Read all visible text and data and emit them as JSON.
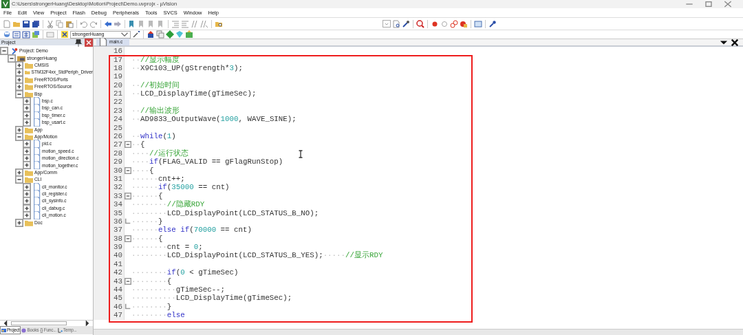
{
  "window": {
    "title": "C:\\Users\\strongerHuang\\Desktop\\Motion\\Project\\Demo.uvprojx - µVision"
  },
  "menu": [
    "File",
    "Edit",
    "View",
    "Project",
    "Flash",
    "Debug",
    "Peripherals",
    "Tools",
    "SVCS",
    "Window",
    "Help"
  ],
  "toolbar": {
    "target": "strongerHuang"
  },
  "project_panel": {
    "title": "Project",
    "tree": [
      {
        "kind": "project",
        "label": "Project: Demo",
        "expanded": true,
        "children": [
          {
            "kind": "target",
            "label": "strongerHuang",
            "expanded": true,
            "children": [
              {
                "kind": "folder",
                "label": "CMSIS",
                "expanded": false
              },
              {
                "kind": "folder",
                "label": "STM32F4xx_StdPeriph_Driver",
                "expanded": false
              },
              {
                "kind": "folder",
                "label": "FreeRTOS/Ports",
                "expanded": false
              },
              {
                "kind": "folder",
                "label": "FreeRTOS/Source",
                "expanded": false
              },
              {
                "kind": "folder",
                "label": "Bsp",
                "expanded": true,
                "children": [
                  {
                    "kind": "file",
                    "label": "bsp.c",
                    "expanded": false
                  },
                  {
                    "kind": "file",
                    "label": "bsp_can.c",
                    "expanded": false
                  },
                  {
                    "kind": "file",
                    "label": "bsp_timer.c",
                    "expanded": false
                  },
                  {
                    "kind": "file",
                    "label": "bsp_usart.c",
                    "expanded": false
                  }
                ]
              },
              {
                "kind": "folder",
                "label": "App",
                "expanded": false
              },
              {
                "kind": "folder",
                "label": "App/Motion",
                "expanded": true,
                "children": [
                  {
                    "kind": "file",
                    "label": "pid.c",
                    "expanded": false
                  },
                  {
                    "kind": "file",
                    "label": "motion_speed.c",
                    "expanded": false
                  },
                  {
                    "kind": "file",
                    "label": "motion_direction.c",
                    "expanded": false
                  },
                  {
                    "kind": "file",
                    "label": "motion_together.c",
                    "expanded": false
                  }
                ]
              },
              {
                "kind": "folder",
                "label": "App/Comm",
                "expanded": false
              },
              {
                "kind": "folder",
                "label": "CLI",
                "expanded": true,
                "children": [
                  {
                    "kind": "file",
                    "label": "cli_monitor.c",
                    "expanded": false
                  },
                  {
                    "kind": "file",
                    "label": "cli_register.c",
                    "expanded": false
                  },
                  {
                    "kind": "file",
                    "label": "cli_sysinfo.c",
                    "expanded": false
                  },
                  {
                    "kind": "file",
                    "label": "cli_dabug.c",
                    "expanded": false
                  },
                  {
                    "kind": "file",
                    "label": "cli_motion.c",
                    "expanded": false
                  }
                ]
              },
              {
                "kind": "folder",
                "label": "Doc",
                "expanded": false
              }
            ]
          }
        ]
      }
    ],
    "tabs": [
      {
        "label": "Project",
        "selected": true
      },
      {
        "label": "Books",
        "selected": false
      },
      {
        "label": "{} Func...",
        "selected": false
      },
      {
        "label": "Temp...",
        "selected": false
      }
    ]
  },
  "editor": {
    "tabs": [
      {
        "label": "main.c",
        "selected": true
      }
    ],
    "lines": [
      {
        "n": "16"
      },
      {
        "n": "17",
        "tokens": [
          {
            "kind": "ws",
            "text": "··"
          },
          {
            "kind": "cmt",
            "text": "//显示幅度"
          }
        ]
      },
      {
        "n": "18",
        "tokens": [
          {
            "kind": "ws",
            "text": "··"
          },
          {
            "kind": "code",
            "text": "X9C103_UP(gStrength*"
          },
          {
            "kind": "num",
            "text": "3"
          },
          {
            "kind": "code",
            "text": ");"
          }
        ]
      },
      {
        "n": "19"
      },
      {
        "n": "20",
        "tokens": [
          {
            "kind": "ws",
            "text": "··"
          },
          {
            "kind": "cmt",
            "text": "//初始时间"
          }
        ]
      },
      {
        "n": "21",
        "tokens": [
          {
            "kind": "ws",
            "text": "··"
          },
          {
            "kind": "code",
            "text": "LCD_DisplayTime(gTimeSec);"
          }
        ]
      },
      {
        "n": "22"
      },
      {
        "n": "23",
        "tokens": [
          {
            "kind": "ws",
            "text": "··"
          },
          {
            "kind": "cmt",
            "text": "//输出波形"
          }
        ]
      },
      {
        "n": "24",
        "tokens": [
          {
            "kind": "ws",
            "text": "··"
          },
          {
            "kind": "code",
            "text": "AD9833_OutputWave("
          },
          {
            "kind": "num",
            "text": "1000"
          },
          {
            "kind": "code",
            "text": ", WAVE_SINE);"
          }
        ]
      },
      {
        "n": "25"
      },
      {
        "n": "26",
        "tokens": [
          {
            "kind": "ws",
            "text": "··"
          },
          {
            "kind": "kw",
            "text": "while"
          },
          {
            "kind": "code",
            "text": "("
          },
          {
            "kind": "num",
            "text": "1"
          },
          {
            "kind": "code",
            "text": ")"
          }
        ]
      },
      {
        "n": "27",
        "fold_start": true,
        "tokens": [
          {
            "kind": "ws",
            "text": "··"
          },
          {
            "kind": "code",
            "text": "{"
          }
        ]
      },
      {
        "n": "28",
        "tokens": [
          {
            "kind": "ws",
            "text": "····"
          },
          {
            "kind": "cmt",
            "text": "//运行状态"
          }
        ]
      },
      {
        "n": "29",
        "tokens": [
          {
            "kind": "ws",
            "text": "····"
          },
          {
            "kind": "kw",
            "text": "if"
          },
          {
            "kind": "code",
            "text": "(FLAG_VALID == gFlagRunStop)"
          }
        ]
      },
      {
        "n": "30",
        "fold_start": true,
        "tokens": [
          {
            "kind": "ws",
            "text": "····"
          },
          {
            "kind": "code",
            "text": "{"
          }
        ]
      },
      {
        "n": "31",
        "tokens": [
          {
            "kind": "ws",
            "text": "······"
          },
          {
            "kind": "code",
            "text": "cnt++;"
          }
        ]
      },
      {
        "n": "32",
        "tokens": [
          {
            "kind": "ws",
            "text": "······"
          },
          {
            "kind": "kw",
            "text": "if"
          },
          {
            "kind": "code",
            "text": "("
          },
          {
            "kind": "num",
            "text": "35000"
          },
          {
            "kind": "code",
            "text": " == cnt)"
          }
        ]
      },
      {
        "n": "33",
        "fold_start": true,
        "tokens": [
          {
            "kind": "ws",
            "text": "······"
          },
          {
            "kind": "code",
            "text": "{"
          }
        ]
      },
      {
        "n": "34",
        "tokens": [
          {
            "kind": "ws",
            "text": "········"
          },
          {
            "kind": "cmt",
            "text": "//隐藏RDY"
          }
        ]
      },
      {
        "n": "35",
        "tokens": [
          {
            "kind": "ws",
            "text": "········"
          },
          {
            "kind": "code",
            "text": "LCD_DisplayPoint(LCD_STATUS_B_NO);"
          }
        ]
      },
      {
        "n": "36",
        "fold_end": true,
        "tokens": [
          {
            "kind": "ws",
            "text": "······"
          },
          {
            "kind": "code",
            "text": "}"
          }
        ]
      },
      {
        "n": "37",
        "tokens": [
          {
            "kind": "ws",
            "text": "······"
          },
          {
            "kind": "kw",
            "text": "else if"
          },
          {
            "kind": "code",
            "text": "("
          },
          {
            "kind": "num",
            "text": "70000"
          },
          {
            "kind": "code",
            "text": " == cnt)"
          }
        ]
      },
      {
        "n": "38",
        "fold_start": true,
        "tokens": [
          {
            "kind": "ws",
            "text": "······"
          },
          {
            "kind": "code",
            "text": "{"
          }
        ]
      },
      {
        "n": "39",
        "tokens": [
          {
            "kind": "ws",
            "text": "········"
          },
          {
            "kind": "code",
            "text": "cnt = "
          },
          {
            "kind": "num",
            "text": "0"
          },
          {
            "kind": "code",
            "text": ";"
          }
        ]
      },
      {
        "n": "40",
        "tokens": [
          {
            "kind": "ws",
            "text": "········"
          },
          {
            "kind": "code",
            "text": "LCD_DisplayPoint(LCD_STATUS_B_YES);"
          },
          {
            "kind": "ws",
            "text": "·····"
          },
          {
            "kind": "cmt",
            "text": "//显示RDY"
          }
        ]
      },
      {
        "n": "41"
      },
      {
        "n": "42",
        "tokens": [
          {
            "kind": "ws",
            "text": "········"
          },
          {
            "kind": "kw",
            "text": "if"
          },
          {
            "kind": "code",
            "text": "("
          },
          {
            "kind": "num",
            "text": "0"
          },
          {
            "kind": "code",
            "text": " < gTimeSec)"
          }
        ]
      },
      {
        "n": "43",
        "fold_start": true,
        "tokens": [
          {
            "kind": "ws",
            "text": "········"
          },
          {
            "kind": "code",
            "text": "{"
          }
        ]
      },
      {
        "n": "44",
        "tokens": [
          {
            "kind": "ws",
            "text": "··········"
          },
          {
            "kind": "code",
            "text": "gTimeSec--;"
          }
        ]
      },
      {
        "n": "45",
        "tokens": [
          {
            "kind": "ws",
            "text": "··········"
          },
          {
            "kind": "code",
            "text": "LCD_DisplayTime(gTimeSec);"
          }
        ]
      },
      {
        "n": "46",
        "fold_end": true,
        "tokens": [
          {
            "kind": "ws",
            "text": "········"
          },
          {
            "kind": "code",
            "text": "}"
          }
        ]
      },
      {
        "n": "47",
        "tokens": [
          {
            "kind": "ws",
            "text": "········"
          },
          {
            "kind": "kw",
            "text": "else"
          }
        ]
      }
    ]
  }
}
